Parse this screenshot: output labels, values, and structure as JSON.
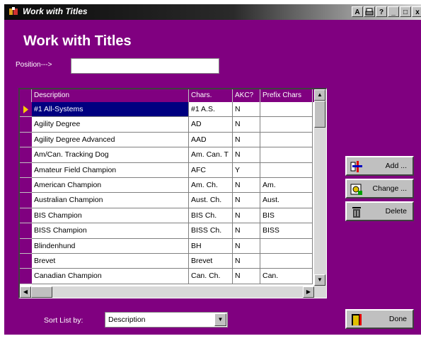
{
  "window": {
    "title": "Work with Titles",
    "title_buttons": [
      "A",
      "?",
      "_",
      "□",
      "x"
    ]
  },
  "heading": "Work with Titles",
  "position": {
    "label": "Position--->",
    "value": ""
  },
  "grid": {
    "columns": [
      "Description",
      "Chars.",
      "AKC?",
      "Prefix Chars"
    ],
    "rows": [
      [
        "#1 All-Systems",
        "#1 A.S.",
        "N",
        ""
      ],
      [
        "Agility Degree",
        "AD",
        "N",
        ""
      ],
      [
        "Agility Degree Advanced",
        "AAD",
        "N",
        ""
      ],
      [
        "Am/Can. Tracking Dog",
        "Am. Can. T",
        "N",
        ""
      ],
      [
        "Amateur Field Champion",
        "AFC",
        "Y",
        ""
      ],
      [
        "American Champion",
        "Am. Ch.",
        "N",
        "Am."
      ],
      [
        "Australian Champion",
        "Aust. Ch.",
        "N",
        "Aust."
      ],
      [
        "BIS Champion",
        "BIS Ch.",
        "N",
        "BIS"
      ],
      [
        "BISS Champion",
        "BISS Ch.",
        "N",
        "BISS"
      ],
      [
        "Blindenhund",
        "BH",
        "N",
        ""
      ],
      [
        "Brevet",
        "Brevet",
        "N",
        ""
      ],
      [
        "Canadian Champion",
        "Can. Ch.",
        "N",
        "Can."
      ]
    ],
    "selected_row": 0
  },
  "buttons": {
    "add": "Add ...",
    "change": "Change ...",
    "delete": "Delete",
    "done": "Done"
  },
  "sort": {
    "label": "Sort List by:",
    "value": "Description"
  },
  "colors": {
    "background": "#800080",
    "selection": "#000080",
    "button_face": "#c0c0c0"
  }
}
